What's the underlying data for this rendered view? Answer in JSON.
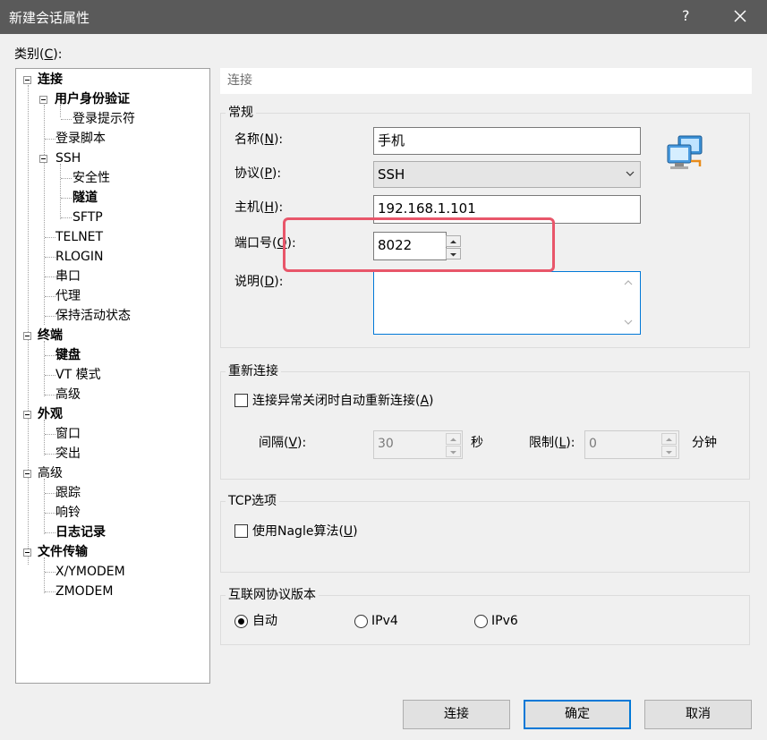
{
  "window": {
    "title": "新建会话属性",
    "help": "?",
    "close": "✕"
  },
  "category": {
    "label": "类别",
    "mnemonic": "C",
    "suffix": "):",
    "prefix": "("
  },
  "tree": [
    {
      "label": "连接",
      "bold": true
    },
    {
      "label": "用户身份验证",
      "bold": true
    },
    {
      "label": "登录提示符",
      "bold": false
    },
    {
      "label": "登录脚本",
      "bold": false
    },
    {
      "label": "SSH",
      "bold": false
    },
    {
      "label": "安全性",
      "bold": false
    },
    {
      "label": "隧道",
      "bold": true
    },
    {
      "label": "SFTP",
      "bold": false
    },
    {
      "label": "TELNET",
      "bold": false
    },
    {
      "label": "RLOGIN",
      "bold": false
    },
    {
      "label": "串口",
      "bold": false
    },
    {
      "label": "代理",
      "bold": false
    },
    {
      "label": "保持活动状态",
      "bold": false
    },
    {
      "label": "终端",
      "bold": true
    },
    {
      "label": "键盘",
      "bold": true
    },
    {
      "label": "VT 模式",
      "bold": false
    },
    {
      "label": "高级",
      "bold": false
    },
    {
      "label": "外观",
      "bold": true
    },
    {
      "label": "窗口",
      "bold": false
    },
    {
      "label": "突出",
      "bold": false
    },
    {
      "label": "高级",
      "bold": false
    },
    {
      "label": "跟踪",
      "bold": false
    },
    {
      "label": "响铃",
      "bold": false
    },
    {
      "label": "日志记录",
      "bold": true
    },
    {
      "label": "文件传输",
      "bold": true
    },
    {
      "label": "X/YMODEM",
      "bold": false
    },
    {
      "label": "ZMODEM",
      "bold": false
    }
  ],
  "header": {
    "title": "连接"
  },
  "general": {
    "title": "常规",
    "name_label": "名称(",
    "name_key": "N",
    "name_suffix": "):",
    "name_value": "手机",
    "protocol_label": "协议(",
    "protocol_key": "P",
    "protocol_suffix": "):",
    "protocol_value": "SSH",
    "host_label": "主机(",
    "host_key": "H",
    "host_suffix": "):",
    "host_value": "192.168.1.101",
    "port_label": "端口号(",
    "port_key": "O",
    "port_suffix": "):",
    "port_value": "8022",
    "desc_label": "说明(",
    "desc_key": "D",
    "desc_suffix": "):",
    "desc_value": ""
  },
  "reconnect": {
    "title": "重新连接",
    "checkbox_label": "连接异常关闭时自动重新连接(",
    "checkbox_key": "A",
    "checkbox_suffix": ")",
    "interval_label": "间隔(",
    "interval_key": "V",
    "interval_suffix": "):",
    "interval_value": "30",
    "interval_unit": "秒",
    "limit_label": "限制(",
    "limit_key": "L",
    "limit_suffix": "):",
    "limit_value": "0",
    "limit_unit": "分钟"
  },
  "tcp": {
    "title": "TCP选项",
    "nagle_label": "使用Nagle算法(",
    "nagle_key": "U",
    "nagle_suffix": ")"
  },
  "ipversion": {
    "title": "互联网协议版本",
    "options": [
      "自动",
      "IPv4",
      "IPv6"
    ],
    "selected": "自动"
  },
  "buttons": {
    "connect": "连接",
    "ok": "确定",
    "cancel": "取消"
  },
  "colors": {
    "highlight": "#e8566a",
    "default_button_border": "#0078d7",
    "titlebar": "#5a5a5a"
  }
}
